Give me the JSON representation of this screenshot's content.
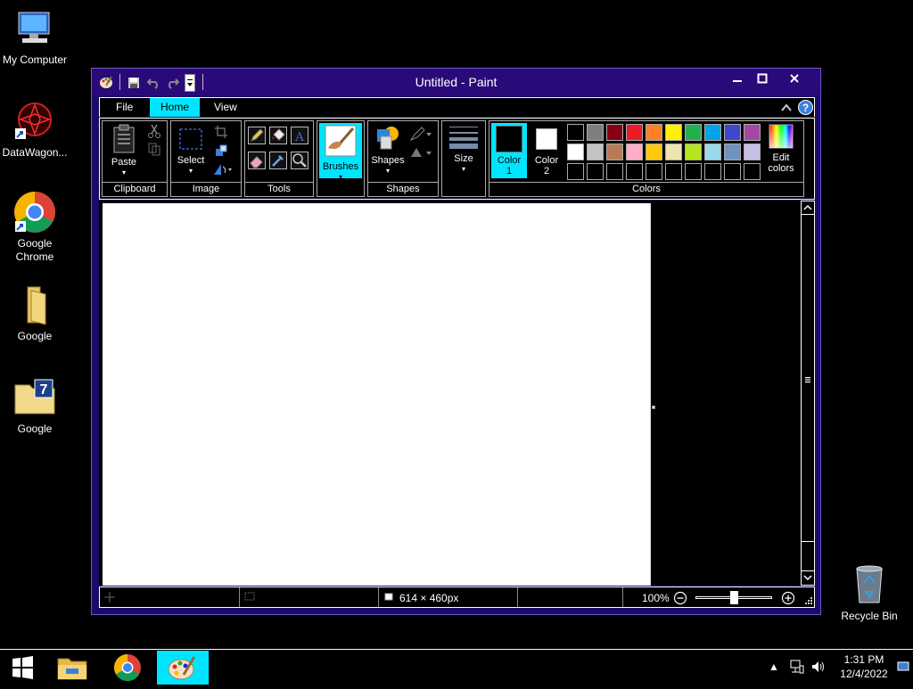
{
  "desktop": {
    "icons": [
      {
        "label": "My Computer"
      },
      {
        "label": "DataWagon..."
      },
      {
        "label": "Google Chrome"
      },
      {
        "label": "Google"
      },
      {
        "label": "Google"
      },
      {
        "label": "Recycle Bin"
      }
    ]
  },
  "window": {
    "title": "Untitled - Paint",
    "tabs": [
      {
        "label": "File"
      },
      {
        "label": "Home"
      },
      {
        "label": "View"
      }
    ],
    "groups": {
      "clipboard": {
        "title": "Clipboard",
        "paste": "Paste"
      },
      "image": {
        "title": "Image",
        "select": "Select"
      },
      "tools": {
        "title": "Tools"
      },
      "brushes": {
        "label": "Brushes"
      },
      "shapes": {
        "title": "Shapes",
        "label": "Shapes"
      },
      "size": {
        "label": "Size"
      },
      "colors": {
        "title": "Colors",
        "color1": "Color 1",
        "color2": "Color 2",
        "edit": "Edit colors",
        "color1_value": "#000000",
        "color2_value": "#ffffff",
        "row1": [
          "#000000",
          "#7f7f7f",
          "#880015",
          "#ed1c24",
          "#ff7f27",
          "#fff200",
          "#22b14c",
          "#00a2e8",
          "#3f48cc",
          "#a349a4"
        ],
        "row2": [
          "#ffffff",
          "#c3c3c3",
          "#b97a57",
          "#ffaec9",
          "#ffc90e",
          "#efe4b0",
          "#b5e61d",
          "#99d9ea",
          "#7092be",
          "#c8bfe7"
        ]
      }
    },
    "status": {
      "dimensions": "614 × 460px",
      "zoom": "100%"
    }
  },
  "taskbar": {
    "time": "1:31 PM",
    "date": "12/4/2022"
  }
}
